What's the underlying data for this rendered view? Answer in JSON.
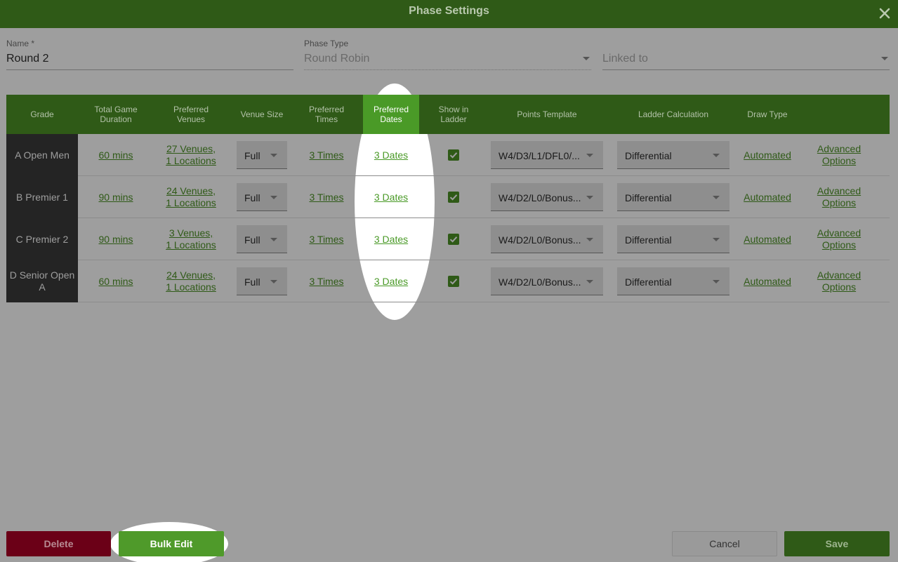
{
  "dialog": {
    "title": "Phase Settings"
  },
  "form": {
    "name": {
      "label": "Name *",
      "value": "Round 2"
    },
    "phase_type": {
      "label": "Phase Type",
      "value": "Round Robin"
    },
    "linked_to": {
      "placeholder": "Linked to"
    }
  },
  "table": {
    "headers": {
      "grade": "Grade",
      "duration": "Total Game Duration",
      "venues": "Preferred Venues",
      "venue_size": "Venue Size",
      "times": "Preferred Times",
      "dates": "Preferred Dates",
      "ladder": "Show in Ladder",
      "points": "Points Template",
      "ladder_calc": "Ladder Calculation",
      "draw_type": "Draw Type"
    },
    "rows": [
      {
        "grade": "A Open Men",
        "duration": "60 mins",
        "venues_line1": "27 Venues,",
        "venues_line2": "1 Locations",
        "venue_size": "Full",
        "times": "3 Times",
        "dates": "3 Dates",
        "show_in_ladder": true,
        "points_template": "W4/D3/L1/DFL0/...",
        "ladder_calc": "Differential",
        "draw_type": "Automated",
        "adv_line1": "Advanced",
        "adv_line2": "Options"
      },
      {
        "grade": "B Premier 1",
        "duration": "90 mins",
        "venues_line1": "24 Venues,",
        "venues_line2": "1 Locations",
        "venue_size": "Full",
        "times": "3 Times",
        "dates": "3 Dates",
        "show_in_ladder": true,
        "points_template": "W4/D2/L0/Bonus...",
        "ladder_calc": "Differential",
        "draw_type": "Automated",
        "adv_line1": "Advanced",
        "adv_line2": "Options"
      },
      {
        "grade": "C Premier 2",
        "duration": "90 mins",
        "venues_line1": "3 Venues,",
        "venues_line2": "1 Locations",
        "venue_size": "Full",
        "times": "3 Times",
        "dates": "3 Dates",
        "show_in_ladder": true,
        "points_template": "W4/D2/L0/Bonus...",
        "ladder_calc": "Differential",
        "draw_type": "Automated",
        "adv_line1": "Advanced",
        "adv_line2": "Options"
      },
      {
        "grade": "D Senior Open A",
        "duration": "60 mins",
        "venues_line1": "24 Venues,",
        "venues_line2": "1 Locations",
        "venue_size": "Full",
        "times": "3 Times",
        "dates": "3 Dates",
        "show_in_ladder": true,
        "points_template": "W4/D2/L0/Bonus...",
        "ladder_calc": "Differential",
        "draw_type": "Automated",
        "adv_line1": "Advanced",
        "adv_line2": "Options"
      }
    ]
  },
  "footer": {
    "delete_label": "Delete",
    "bulk_edit_label": "Bulk Edit",
    "cancel_label": "Cancel",
    "save_label": "Save"
  },
  "colors": {
    "header_green": "#2f5a17",
    "accent_green": "#4f9a2a",
    "delete_red": "#6b0017",
    "overlay_gray": "#9e9e9e"
  }
}
